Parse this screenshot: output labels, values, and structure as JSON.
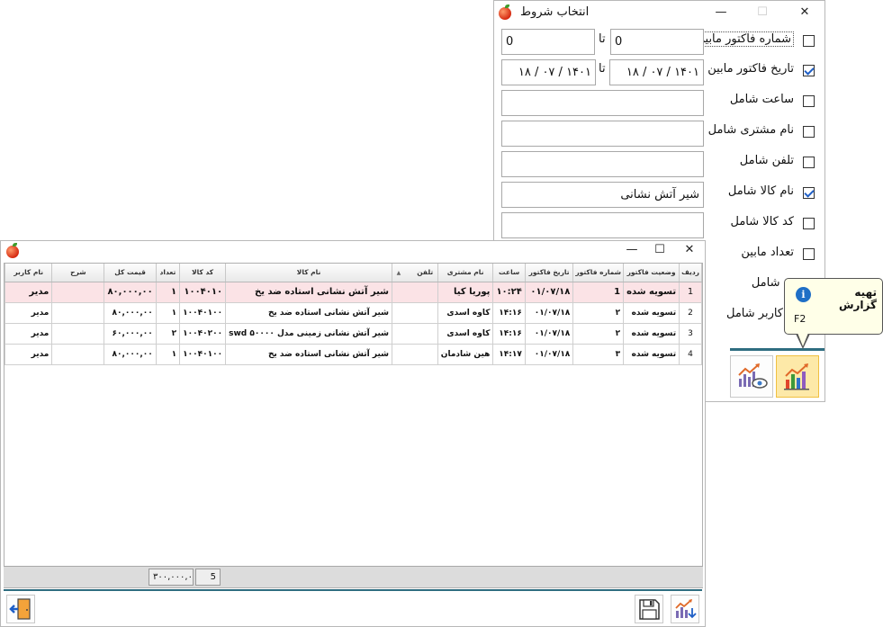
{
  "filter_dialog": {
    "title": "انتخاب شروط",
    "controls": {
      "minimize": "—",
      "maximize": "☐",
      "close": "✕"
    },
    "rows": [
      {
        "label": "شماره فاکتور مابین",
        "checked": false,
        "from": "0",
        "to_label": "تا",
        "to": "0"
      },
      {
        "label": "تاریخ فاکتور مابین",
        "checked": true,
        "from": "۱۸ / ۰۷ / ۱۴۰۱",
        "to_label": "تا",
        "to": "۱۸ / ۰۷ / ۱۴۰۱"
      },
      {
        "label": "ساعت شامل",
        "checked": false,
        "value": ""
      },
      {
        "label": "نام مشتری شامل",
        "checked": false,
        "value": ""
      },
      {
        "label": "تلفن شامل",
        "checked": false,
        "value": ""
      },
      {
        "label": "نام کالا شامل",
        "checked": true,
        "value": "شیر آتش نشانی"
      },
      {
        "label": "کد کالا شامل",
        "checked": false,
        "value": ""
      },
      {
        "label": "تعداد مابین",
        "checked": false
      },
      {
        "label": "ح شامل",
        "checked": false
      },
      {
        "label": "کاربر شامل",
        "checked": false
      }
    ],
    "buttons": [
      {
        "name": "generate-report",
        "icon": "chart-icon"
      },
      {
        "name": "preview-report",
        "icon": "chart-eye-icon"
      }
    ]
  },
  "tooltip": {
    "title": "تهیه گزارش",
    "shortcut": "F2",
    "icon": "info-icon"
  },
  "report_window": {
    "controls": {
      "minimize": "—",
      "maximize": "☐",
      "close": "✕"
    },
    "columns": [
      "ردیف",
      "وضعیت فاکتور",
      "شماره فاکتور",
      "تاریخ فاکتور",
      "ساعت",
      "نام مشتری",
      "تلفن",
      "نام کالا",
      "کد کالا",
      "تعداد",
      "قیمت کل",
      "شرح",
      "نام کاربر"
    ],
    "rows": [
      [
        "1",
        "تسویه شده",
        "1",
        "۰۱/۰۷/۱۸",
        "۱۰:۲۴",
        "پوریا کیا",
        "",
        "شیر آتش نشانی استاده ضد یخ",
        "۱۰۰۴۰۱۰",
        "۱",
        "۸۰,۰۰۰,۰۰",
        "",
        "مدیر"
      ],
      [
        "2",
        "تسویه شده",
        "۲",
        "۰۱/۰۷/۱۸",
        "۱۴:۱۶",
        "کاوه اسدی",
        "",
        "شیر آتش نشانی استاده ضد یخ",
        "۱۰۰۴۰۱۰۰",
        "۱",
        "۸۰,۰۰۰,۰۰",
        "",
        "مدیر"
      ],
      [
        "3",
        "تسویه شده",
        "۲",
        "۰۱/۰۷/۱۸",
        "۱۴:۱۶",
        "کاوه اسدی",
        "",
        "شیر آتش نشانی زمینی مدل swd ۵۰۰۰۰",
        "۱۰۰۴۰۲۰۰",
        "۲",
        "۶۰,۰۰۰,۰۰",
        "",
        "مدیر"
      ],
      [
        "4",
        "تسویه شده",
        "۳",
        "۰۱/۰۷/۱۸",
        "۱۴:۱۷",
        "هین شادمان",
        "",
        "شیر آتش نشانی استاده ضد یخ",
        "۱۰۰۴۰۱۰۰",
        "۱",
        "۸۰,۰۰۰,۰۰",
        "",
        "مدیر"
      ]
    ],
    "selected_row": 0,
    "totals": {
      "quantity": "5",
      "total_price": "۳۰۰,۰۰۰,۰"
    },
    "buttons": [
      {
        "name": "exit",
        "icon": "exit-door-icon"
      },
      {
        "name": "save",
        "icon": "save-icon"
      },
      {
        "name": "export-report",
        "icon": "chart-export-icon"
      }
    ]
  }
}
